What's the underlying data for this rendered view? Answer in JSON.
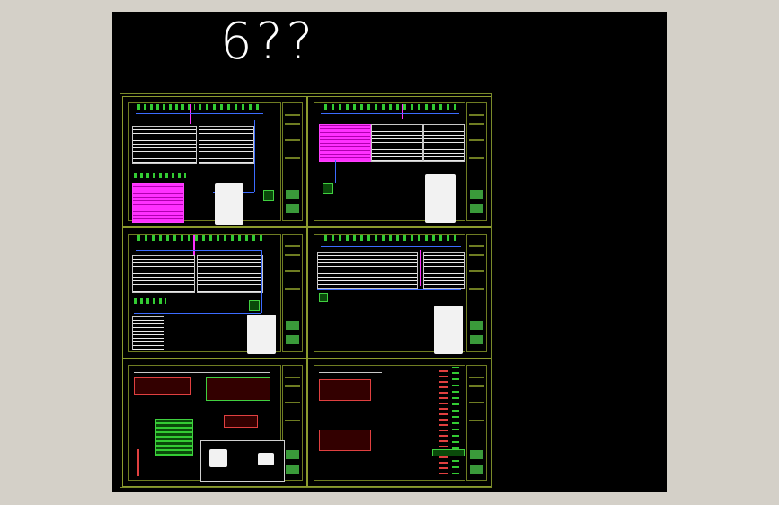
{
  "drawing": {
    "title": "6??"
  },
  "colors": {
    "background": "#000000",
    "viewport_frame": "#d4d0c8",
    "sheet_border": "#8c9c2e",
    "circuit_green": "#33cc33",
    "bus_blue": "#3c6cff",
    "highlight_magenta": "#ff30ff",
    "table_white": "#eaeaea",
    "plan_red": "#e04040"
  },
  "sheets": [
    {
      "position": "top-left"
    },
    {
      "position": "top-right"
    },
    {
      "position": "middle-left"
    },
    {
      "position": "middle-right"
    },
    {
      "position": "bottom-left"
    },
    {
      "position": "bottom-right"
    }
  ]
}
